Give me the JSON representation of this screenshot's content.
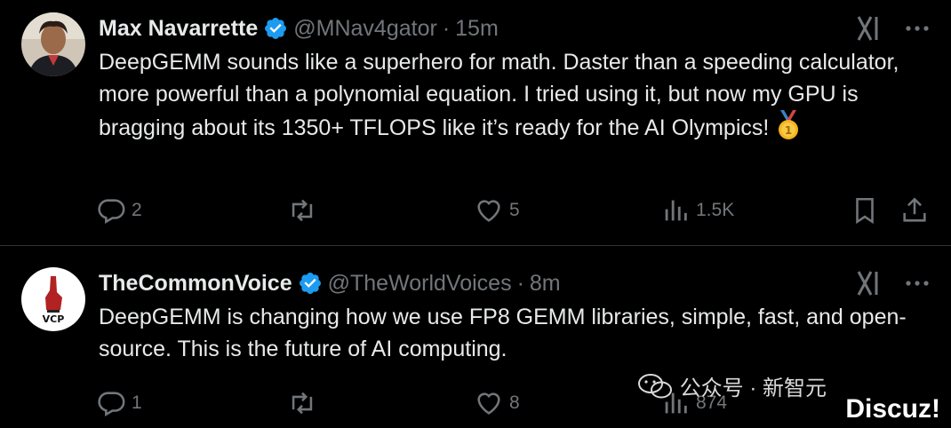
{
  "tweets": [
    {
      "name": "Max Navarrette",
      "handle": "@MNav4gator",
      "separator": "·",
      "time": "15m",
      "text": "DeepGEMM sounds like a superhero for math. Daster than a speeding calculator, more powerful than a polynomial equation. I tried using it, but now my GPU is bragging about its 1350+ TFLOPS like it’s ready for the AI Olympics!",
      "replies": "2",
      "retweets": "",
      "likes": "5",
      "views": "1.5K"
    },
    {
      "name": "TheCommonVoice",
      "handle": "@TheWorldVoices",
      "separator": "·",
      "time": "8m",
      "text": "DeepGEMM is changing how we use FP8 GEMM libraries, simple, fast, and open-source. This is the future of AI computing.",
      "replies": "1",
      "retweets": "",
      "likes": "8",
      "views": "874",
      "avatar_text": "VCP"
    }
  ],
  "watermark": {
    "text": "公众号 · 新智元",
    "brand": "Discuz!"
  },
  "colors": {
    "background": "#000000",
    "text": "#e7e9ea",
    "secondary": "#71767b",
    "verified": "#1d9bf0",
    "divider": "#2f3336"
  },
  "icons": [
    "verified-badge-icon",
    "grok-icon",
    "more-icon",
    "reply-icon",
    "retweet-icon",
    "like-icon",
    "views-icon",
    "bookmark-icon",
    "share-icon",
    "medal-emoji"
  ]
}
